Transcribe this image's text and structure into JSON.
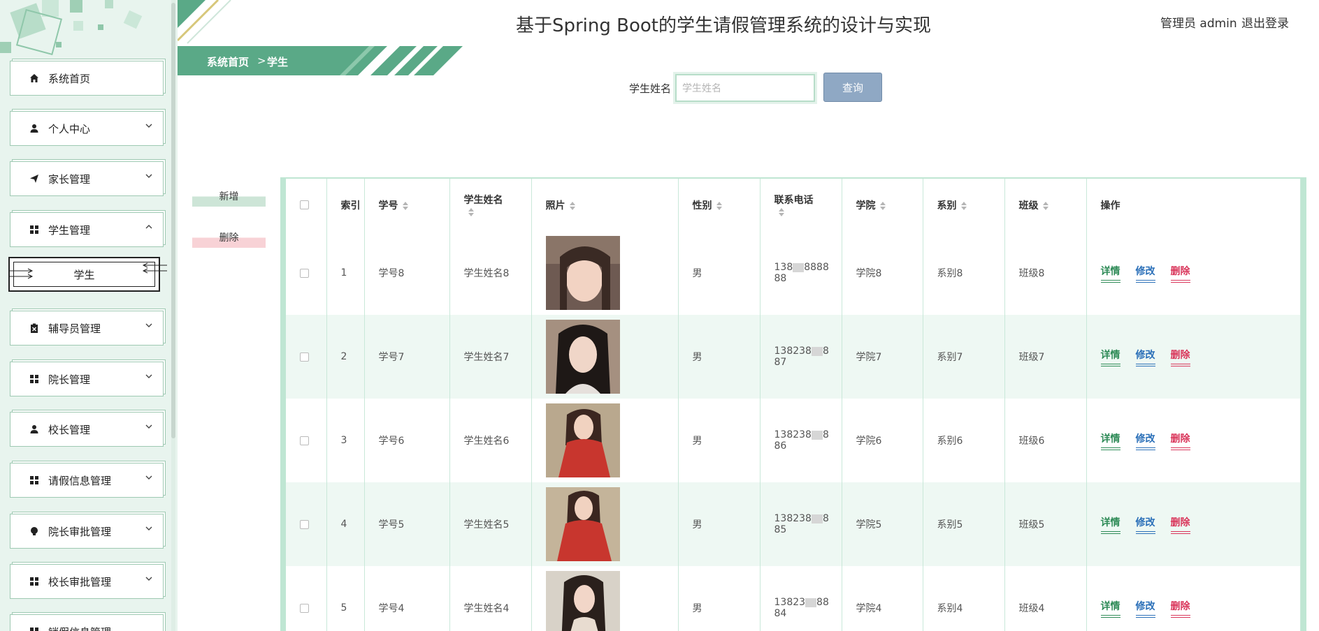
{
  "header": {
    "title": "基于Spring Boot的学生请假管理系统的设计与实现",
    "user": "管理员 admin",
    "logout": "退出登录"
  },
  "sidebar": {
    "items": [
      {
        "label": "系统首页",
        "icon": "home-icon"
      },
      {
        "label": "个人中心",
        "icon": "person-icon"
      },
      {
        "label": "家长管理",
        "icon": "paper-plane-icon"
      },
      {
        "label": "学生管理",
        "icon": "grid-icon",
        "expanded": true,
        "sub": "学生"
      },
      {
        "label": "辅导员管理",
        "icon": "clipboard-icon"
      },
      {
        "label": "院长管理",
        "icon": "grid-icon"
      },
      {
        "label": "校长管理",
        "icon": "person-icon"
      },
      {
        "label": "请假信息管理",
        "icon": "grid-icon"
      },
      {
        "label": "院长审批管理",
        "icon": "bulb-icon"
      },
      {
        "label": "校长审批管理",
        "icon": "grid-icon"
      },
      {
        "label": "销假信息管理",
        "icon": "grid-icon"
      }
    ]
  },
  "breadcrumb": {
    "home": "系统首页",
    "separator": ">",
    "current": "学生"
  },
  "search": {
    "label": "学生姓名",
    "placeholder": "学生姓名",
    "button": "查询"
  },
  "actions": {
    "add": "新增",
    "delete": "删除"
  },
  "table": {
    "headers": {
      "index": "索引",
      "id": "学号",
      "name": "学生姓名",
      "photo": "照片",
      "gender": "性别",
      "phone": "联系电话",
      "college": "学院",
      "department": "系别",
      "class": "班级",
      "ops": "操作"
    },
    "op_labels": {
      "detail": "详情",
      "edit": "修改",
      "delete": "删除"
    },
    "rows": [
      {
        "index": "1",
        "id": "学号8",
        "name": "学生姓名8",
        "gender": "男",
        "phone_a": "138",
        "phone_b": "8888",
        "phone_c": "88",
        "college": "学院8",
        "department": "系别8",
        "class": "班级8"
      },
      {
        "index": "2",
        "id": "学号7",
        "name": "学生姓名7",
        "gender": "男",
        "phone_a": "138238",
        "phone_b": "8",
        "phone_c": "87",
        "college": "学院7",
        "department": "系别7",
        "class": "班级7"
      },
      {
        "index": "3",
        "id": "学号6",
        "name": "学生姓名6",
        "gender": "男",
        "phone_a": "138238",
        "phone_b": "8",
        "phone_c": "86",
        "college": "学院6",
        "department": "系别6",
        "class": "班级6"
      },
      {
        "index": "4",
        "id": "学号5",
        "name": "学生姓名5",
        "gender": "男",
        "phone_a": "138238",
        "phone_b": "8",
        "phone_c": "85",
        "college": "学院5",
        "department": "系别5",
        "class": "班级5"
      },
      {
        "index": "5",
        "id": "学号4",
        "name": "学生姓名4",
        "gender": "男",
        "phone_a": "13823",
        "phone_b": "88",
        "phone_c": "84",
        "college": "学院4",
        "department": "系别4",
        "class": "班级4"
      }
    ]
  },
  "colors": {
    "accent": "#5aa987",
    "sidebar_bg": "#e8f4ee",
    "row_stripe": "#eef8f3",
    "search_button": "#8fa8c4",
    "detail": "#2e8b57",
    "edit": "#2a6fb8",
    "delete": "#d9355a"
  }
}
